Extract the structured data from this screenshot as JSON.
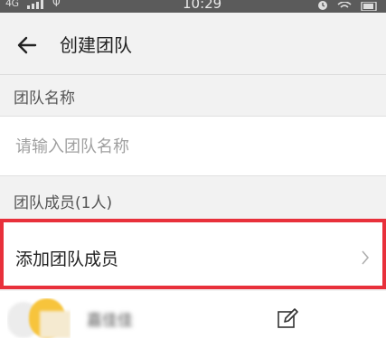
{
  "status_bar": {
    "network": "4G",
    "time": "10:29",
    "icons": [
      "signal-icon",
      "usb-icon",
      "alarm-icon",
      "wifi-icon",
      "battery-icon"
    ]
  },
  "header": {
    "title": "创建团队",
    "back_icon": "back-arrow-icon"
  },
  "team_name": {
    "label": "团队名称",
    "input_value": "",
    "placeholder": "请输入团队名称"
  },
  "members": {
    "label": "团队成员(1人)",
    "add_label": "添加团队成员",
    "add_icon": "chevron-right-icon",
    "list": [
      {
        "name": "嘉佳佳",
        "edit_icon": "edit-icon"
      }
    ]
  },
  "colors": {
    "status_bar_bg": "#5b5b5b",
    "page_bg": "#f2f2f2",
    "highlight_border": "#e8303b",
    "avatar_accent": "#f7c43c"
  }
}
